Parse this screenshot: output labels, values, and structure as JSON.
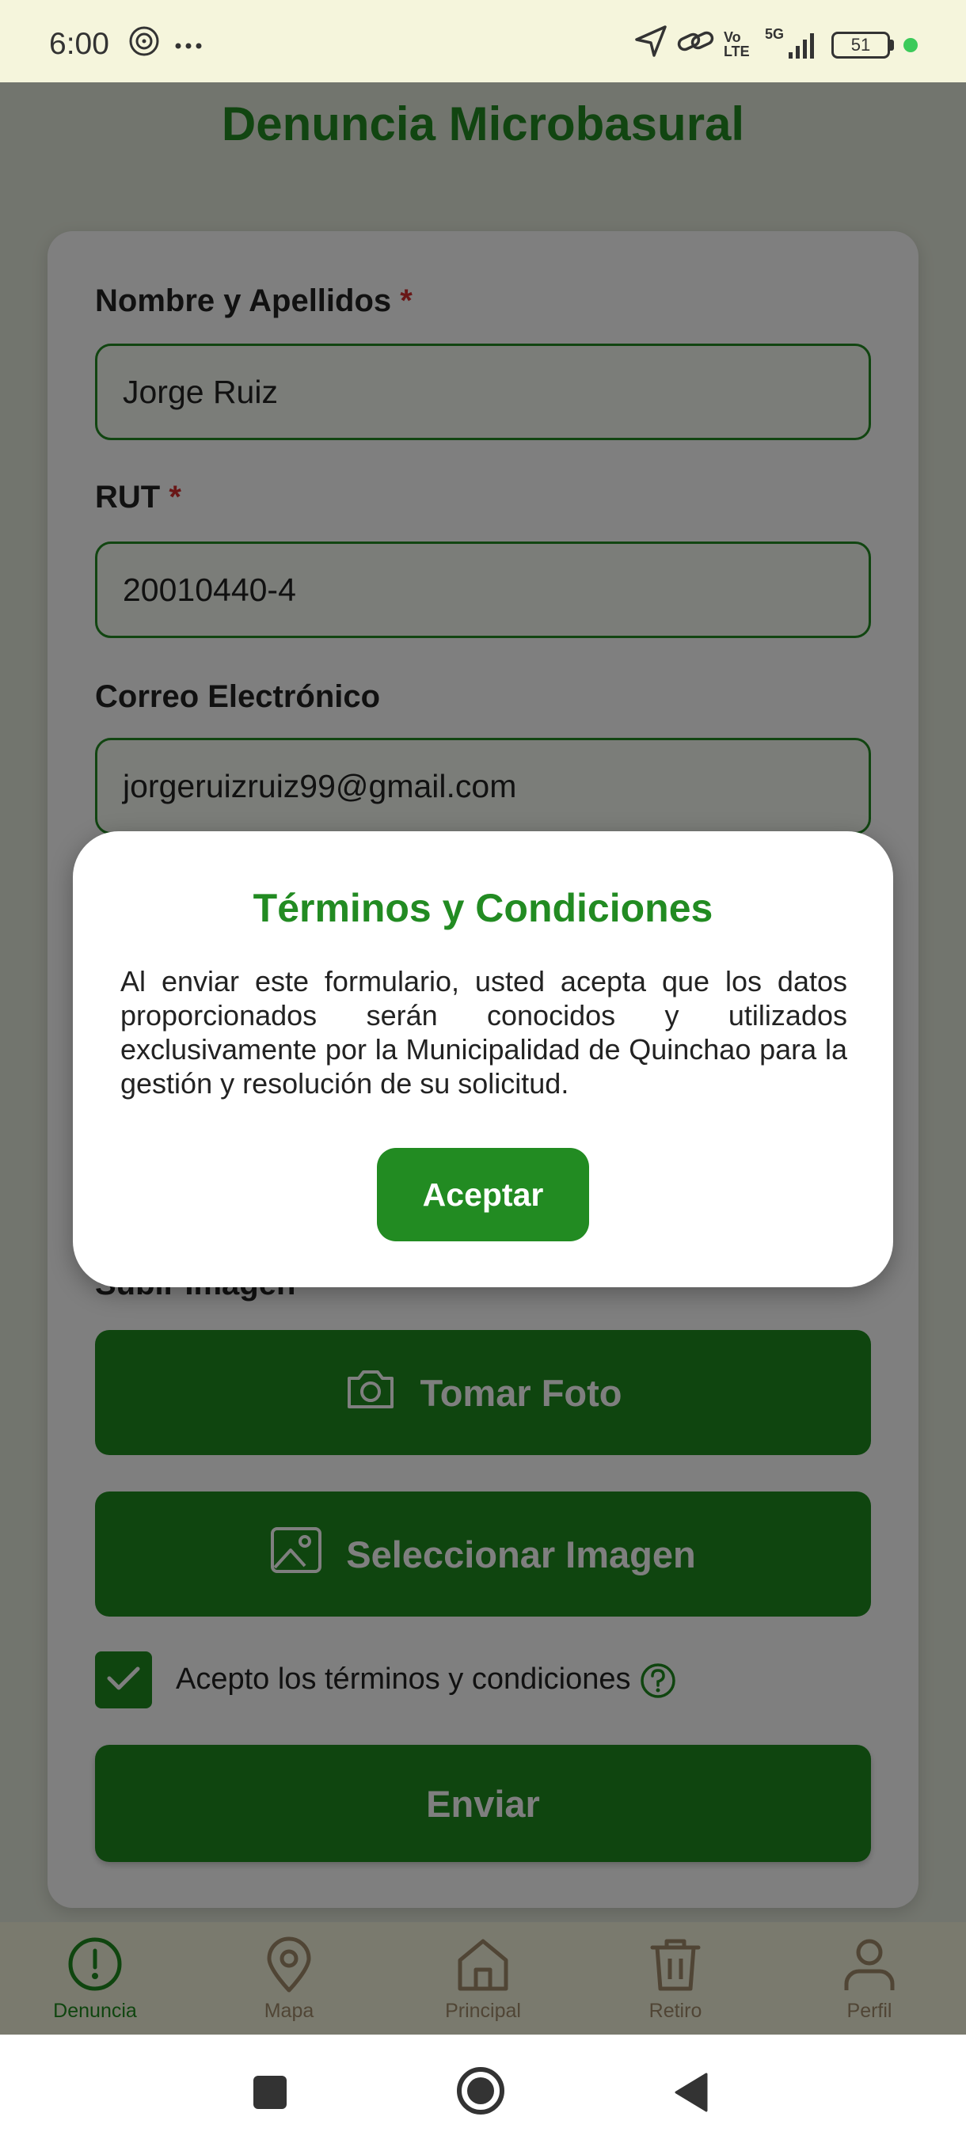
{
  "status_bar": {
    "time": "6:00",
    "icons": [
      "hotspot-icon",
      "more-icon",
      "location-icon",
      "link-icon",
      "signal-icon"
    ],
    "network_volte": "Vo LTE",
    "network_5g": "5G",
    "battery": "51"
  },
  "app": {
    "title": "Denuncia Microbasural"
  },
  "form": {
    "name_label": "Nombre y Apellidos",
    "name_value": "Jorge Ruiz",
    "rut_label": "RUT",
    "rut_value": "20010440-4",
    "required_mark": "*",
    "email_label": "Correo Electrónico",
    "email_value": "jorgeruizruiz99@gmail.com",
    "upload_label": "Subir Imagen",
    "take_photo_label": "Tomar Foto",
    "select_image_label": "Seleccionar Imagen",
    "terms_checkbox_label": "Acepto los términos y condiciones",
    "terms_checked": true,
    "submit_label": "Enviar"
  },
  "tabs": [
    {
      "label": "Denuncia",
      "icon": "alert-circle-icon",
      "active": true
    },
    {
      "label": "Mapa",
      "icon": "map-pin-icon",
      "active": false
    },
    {
      "label": "Principal",
      "icon": "home-icon",
      "active": false
    },
    {
      "label": "Retiro",
      "icon": "trash-icon",
      "active": false
    },
    {
      "label": "Perfil",
      "icon": "user-icon",
      "active": false
    }
  ],
  "modal": {
    "title": "Términos y Condiciones",
    "body": "Al enviar este formulario, usted acepta que los datos proporcionados serán conocidos y utilizados exclusivamente por la Municipalidad de Quinchao para la gestión y resolución de su solicitud.",
    "accept_label": "Aceptar"
  },
  "colors": {
    "brand_green": "#228b22",
    "required_red": "#d32f2f",
    "bar_background": "#f5f5dc",
    "inactive_tab": "#a08a6a"
  }
}
